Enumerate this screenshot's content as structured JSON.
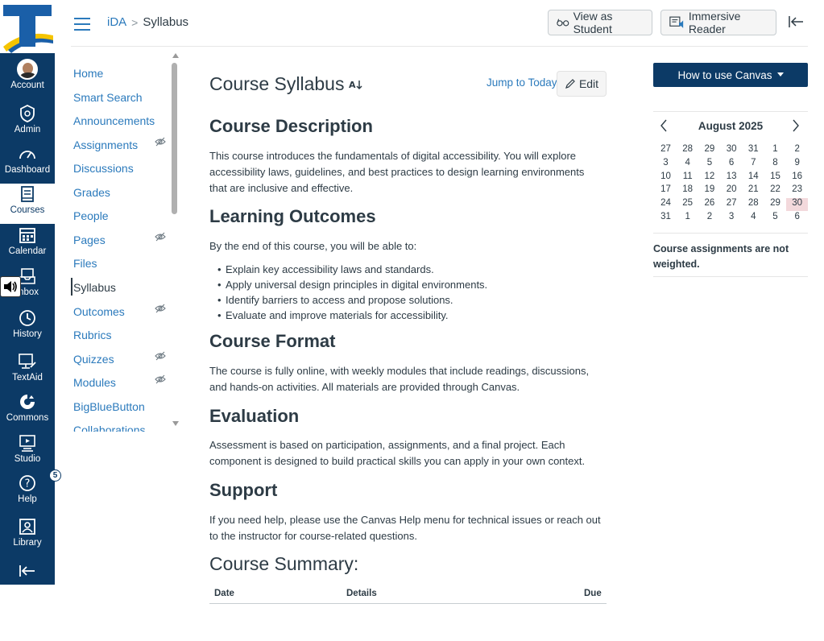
{
  "global_nav": {
    "items": [
      {
        "label": "Account",
        "icon": "avatar"
      },
      {
        "label": "Admin",
        "icon": "shield-icon"
      },
      {
        "label": "Dashboard",
        "icon": "speedometer-icon"
      },
      {
        "label": "Courses",
        "icon": "book-icon"
      },
      {
        "label": "Calendar",
        "icon": "calendar-icon"
      },
      {
        "label": "Inbox",
        "icon": "inbox-icon"
      },
      {
        "label": "History",
        "icon": "clock-icon"
      },
      {
        "label": "TextAid",
        "icon": "textaid-icon"
      },
      {
        "label": "Commons",
        "icon": "commons-icon"
      },
      {
        "label": "Studio",
        "icon": "studio-icon"
      },
      {
        "label": "Help",
        "icon": "help-icon"
      },
      {
        "label": "Library",
        "icon": "library-icon"
      }
    ],
    "help_badge": "5",
    "active": "Courses",
    "colors": {
      "background": "#0c3a66",
      "logo_blue": "#1a5fa8",
      "logo_yellow": "#f5c400"
    }
  },
  "header": {
    "breadcrumb": {
      "course": "iDA",
      "separator": ">",
      "current": "Syllabus"
    },
    "view_as_student": "View as Student",
    "immersive_reader": "Immersive Reader"
  },
  "course_nav": {
    "items": [
      {
        "label": "Home",
        "hidden": false
      },
      {
        "label": "Smart Search",
        "hidden": false
      },
      {
        "label": "Announcements",
        "hidden": false
      },
      {
        "label": "Assignments",
        "hidden": true
      },
      {
        "label": "Discussions",
        "hidden": false
      },
      {
        "label": "Grades",
        "hidden": false
      },
      {
        "label": "People",
        "hidden": false
      },
      {
        "label": "Pages",
        "hidden": true
      },
      {
        "label": "Files",
        "hidden": false
      },
      {
        "label": "Syllabus",
        "hidden": false
      },
      {
        "label": "Outcomes",
        "hidden": true
      },
      {
        "label": "Rubrics",
        "hidden": false
      },
      {
        "label": "Quizzes",
        "hidden": true
      },
      {
        "label": "Modules",
        "hidden": true
      },
      {
        "label": "BigBlueButton",
        "hidden": false
      },
      {
        "label": "Collaborations",
        "hidden": false
      }
    ],
    "active": "Syllabus",
    "link_color": "#2b7abc"
  },
  "main": {
    "title": "Course Syllabus",
    "jump_to_today": "Jump to Today",
    "edit": "Edit",
    "sections": [
      {
        "heading": "Course Description",
        "text": "This course introduces the fundamentals of digital accessibility. You will explore accessibility laws, guidelines, and best practices to design learning environments that are inclusive and effective."
      },
      {
        "heading": "Learning Outcomes",
        "text": "By the end of this course, you will be able to:",
        "list": [
          "Explain key accessibility laws and standards.",
          "Apply universal design principles in digital environments.",
          "Identify barriers to access and propose solutions.",
          "Evaluate and improve materials for accessibility."
        ]
      },
      {
        "heading": "Course Format",
        "text": "The course is fully online, with weekly modules that include readings, discussions, and hands-on activities. All materials are provided through Canvas."
      },
      {
        "heading": "Evaluation",
        "text": "Assessment is based on participation, assignments, and a final project. Each component is designed to build practical skills you can apply in your own context."
      },
      {
        "heading": "Support",
        "text": "If you need help, please use the Canvas Help menu for technical issues or reach out to the instructor for course-related questions."
      }
    ],
    "summary": {
      "heading": "Course Summary:",
      "columns": [
        "Date",
        "Details",
        "Due"
      ]
    }
  },
  "sidebar": {
    "how_to_use": "How to use Canvas",
    "calendar": {
      "month": "August 2025",
      "weeks": [
        [
          "27",
          "28",
          "29",
          "30",
          "31",
          "1",
          "2"
        ],
        [
          "3",
          "4",
          "5",
          "6",
          "7",
          "8",
          "9"
        ],
        [
          "10",
          "11",
          "12",
          "13",
          "14",
          "15",
          "16"
        ],
        [
          "17",
          "18",
          "19",
          "20",
          "21",
          "22",
          "23"
        ],
        [
          "24",
          "25",
          "26",
          "27",
          "28",
          "29",
          "30"
        ],
        [
          "31",
          "1",
          "2",
          "3",
          "4",
          "5",
          "6"
        ]
      ],
      "today": "30"
    },
    "weights_note": "Course assignments are not weighted."
  }
}
